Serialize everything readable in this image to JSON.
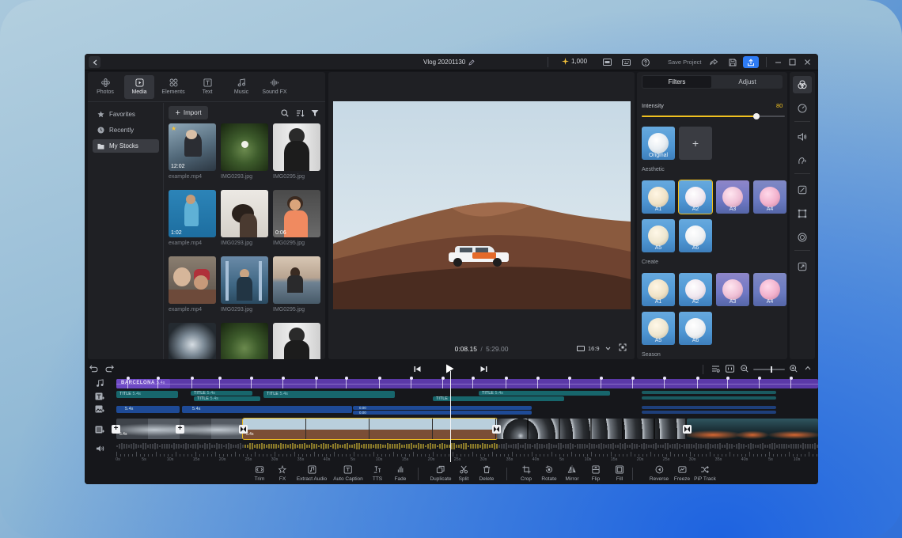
{
  "titlebar": {
    "project_title": "Vlog 20201130",
    "credits": "1,000",
    "save_project": "Save Project",
    "accent": "#2e7bf3"
  },
  "media_panel": {
    "tabs": [
      {
        "label": "Photos",
        "icon": "photos-icon"
      },
      {
        "label": "Media",
        "icon": "media-icon"
      },
      {
        "label": "Elements",
        "icon": "elements-icon"
      },
      {
        "label": "Text",
        "icon": "text-icon"
      },
      {
        "label": "Music",
        "icon": "music-icon"
      },
      {
        "label": "Sound FX",
        "icon": "sound-fx-icon"
      }
    ],
    "sidebar": [
      {
        "label": "Favorites",
        "icon": "star-icon"
      },
      {
        "label": "Recently",
        "icon": "clock-icon"
      },
      {
        "label": "My Stocks",
        "icon": "folder-icon"
      }
    ],
    "import_label": "Import",
    "items": [
      {
        "name": "example.mp4",
        "duration": "12:02"
      },
      {
        "name": "IMG0293.jpg",
        "duration": ""
      },
      {
        "name": "IMG0295.jpg",
        "duration": ""
      },
      {
        "name": "example.mp4",
        "duration": "1:02"
      },
      {
        "name": "IMG0293.jpg",
        "duration": ""
      },
      {
        "name": "IMG0295.jpg",
        "duration": "0:06"
      },
      {
        "name": "example.mp4",
        "duration": ""
      },
      {
        "name": "IMG0293.jpg",
        "duration": ""
      },
      {
        "name": "IMG0295.jpg",
        "duration": ""
      }
    ]
  },
  "preview": {
    "current_time": "0:08.15",
    "separator": "/",
    "total_time": "5:29.00",
    "aspect_ratio": "16:9"
  },
  "filters_panel": {
    "tabs": [
      "Filters",
      "Adjust"
    ],
    "intensity_label": "Intensity",
    "intensity_value": "80",
    "intensity_level": 0.8,
    "original_label": "Original",
    "sections": [
      {
        "title": "Aesthetic",
        "items": [
          "A1",
          "A2",
          "A3",
          "A4",
          "A5",
          "A6"
        ]
      },
      {
        "title": "Create",
        "items": [
          "A1",
          "A2",
          "A3",
          "A4",
          "A5",
          "A6"
        ]
      },
      {
        "title": "Season",
        "items": []
      }
    ],
    "accent": "#f0c020"
  },
  "timeline": {
    "tracks": {
      "music_clip": "BARCELONA",
      "music_len": "5.4s",
      "title_label": "TITLE",
      "title_len": "5.4s",
      "sub_len": "5.4s",
      "pip_num1": "0.00",
      "pip_num2": "0.00",
      "video_len": "5.4s"
    },
    "ruler_labels": [
      "0s",
      "5s",
      "10s",
      "15s",
      "20s",
      "25s",
      "30s",
      "35s",
      "40s",
      "5s",
      "10s",
      "15s",
      "20s",
      "25s",
      "30s",
      "35s",
      "40s",
      "5s",
      "10s",
      "15s",
      "20s",
      "25s",
      "30s",
      "35s",
      "40s",
      "5s",
      "10s",
      "15s"
    ]
  },
  "toolbar": [
    {
      "label": "Trim",
      "icon": "trim-icon"
    },
    {
      "label": "FX",
      "icon": "fx-icon"
    },
    {
      "label": "Extract Audio",
      "icon": "extract-audio-icon"
    },
    {
      "label": "Auto Caption",
      "icon": "auto-caption-icon"
    },
    {
      "label": "TTS",
      "icon": "tts-icon"
    },
    {
      "label": "Fade",
      "icon": "fade-icon"
    },
    {
      "label": "Duplicate",
      "icon": "duplicate-icon"
    },
    {
      "label": "Split",
      "icon": "split-icon"
    },
    {
      "label": "Delete",
      "icon": "delete-icon"
    },
    {
      "label": "Crop",
      "icon": "crop-icon"
    },
    {
      "label": "Rotate",
      "icon": "rotate-icon"
    },
    {
      "label": "Mirror",
      "icon": "mirror-icon"
    },
    {
      "label": "Flip",
      "icon": "flip-icon"
    },
    {
      "label": "Fill",
      "icon": "fill-icon"
    },
    {
      "label": "Reverse",
      "icon": "reverse-icon"
    },
    {
      "label": "Freeze",
      "icon": "freeze-icon"
    },
    {
      "label": "PiP Track",
      "icon": "pip-track-icon"
    }
  ]
}
